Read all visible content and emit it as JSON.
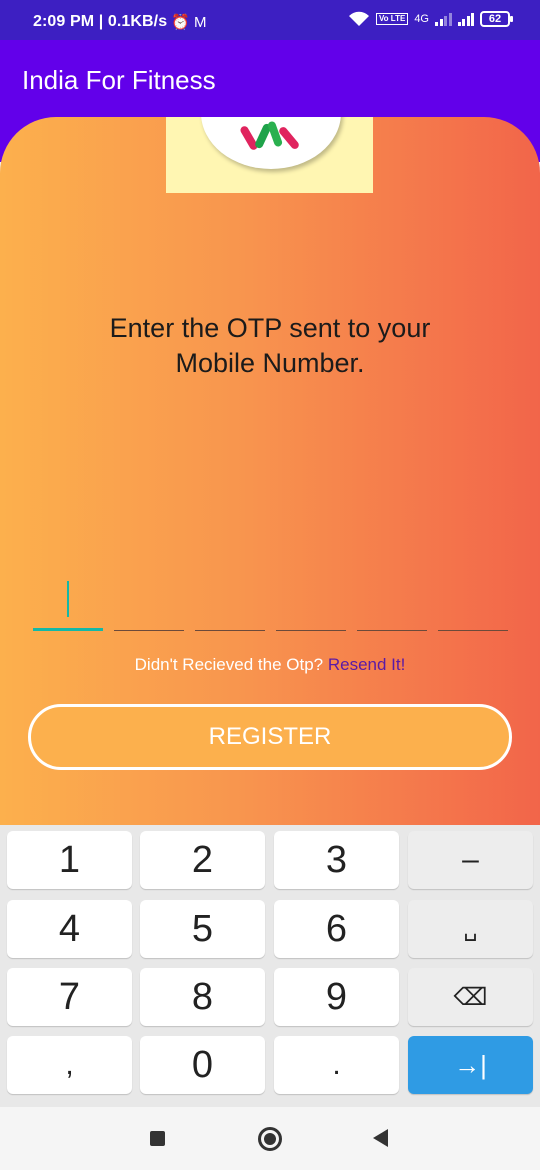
{
  "status_bar": {
    "time": "2:09 PM | 0.1KB/s",
    "alarm_icon": "alarm-off-icon",
    "mail_icon": "gmail-icon",
    "volte": "Vo LTE",
    "network": "4G",
    "battery": "62"
  },
  "app_bar": {
    "title": "India For Fitness"
  },
  "otp": {
    "heading_line1": "Enter the OTP sent to your",
    "heading_line2": "Mobile Number.",
    "boxes": [
      "",
      "",
      "",
      "",
      "",
      ""
    ],
    "resend_prompt": "Didn't Recieved the Otp?",
    "resend_link": "Resend It!",
    "register_label": "REGISTER"
  },
  "keypad": {
    "keys": [
      "1",
      "2",
      "3",
      "–",
      "4",
      "5",
      "6",
      "␣",
      "7",
      "8",
      "9",
      "⌫",
      ",",
      "0",
      ".",
      "→|"
    ]
  },
  "navbar": {
    "recent_icon": "square-icon",
    "home_icon": "circle-icon",
    "back_icon": "triangle-back-icon"
  },
  "colors": {
    "status_bar": "#3d1fc2",
    "app_bar": "#6200ea",
    "gradient_start": "#fcb04d",
    "gradient_end": "#f2654a",
    "accent_teal": "#14b8a6",
    "go_key": "#2f9be4"
  }
}
